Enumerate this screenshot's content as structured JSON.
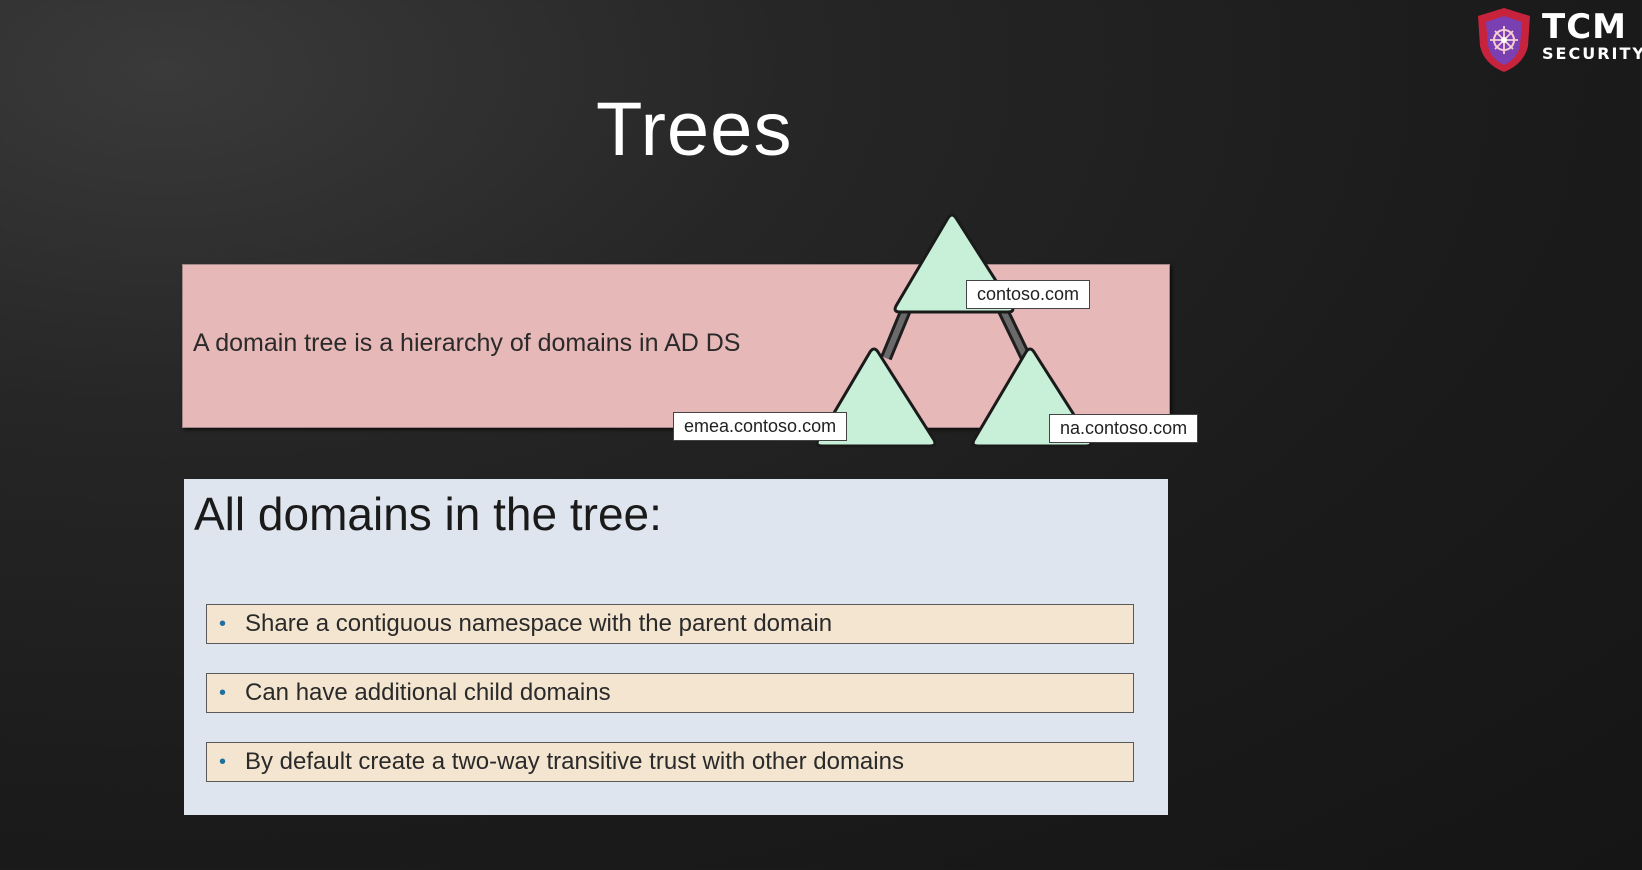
{
  "slide": {
    "title": "Trees"
  },
  "logo": {
    "main": "TCM",
    "sub": "SECURITY",
    "colors": {
      "shield": "#c8233c",
      "accent": "#7a3fb0"
    }
  },
  "definition": {
    "text": "A domain tree is a hierarchy of domains in AD DS"
  },
  "diagram": {
    "root": "contoso.com",
    "left_child": "emea.contoso.com",
    "right_child": "na.contoso.com",
    "node_color": "#c8f0d8"
  },
  "features": {
    "heading": "All domains in the tree:",
    "bullet": "•",
    "items": [
      "Share a contiguous namespace with the parent domain",
      "Can have additional child domains",
      "By default create a two-way transitive trust with other domains"
    ]
  }
}
